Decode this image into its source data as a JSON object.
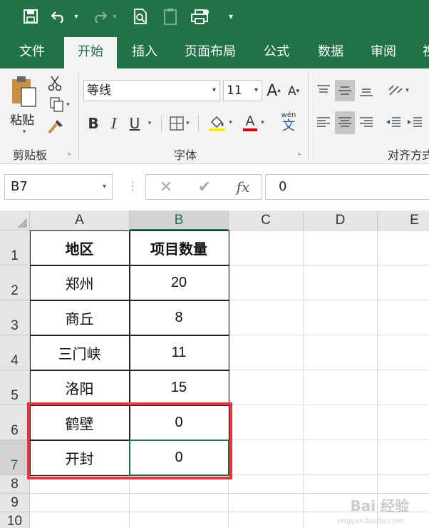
{
  "quick_access": {
    "save_icon": "save-icon",
    "undo_icon": "undo-icon",
    "redo_icon": "redo-icon",
    "print_preview_icon": "print-preview-icon",
    "clipboard_icon": "clipboard-icon",
    "print_icon": "printer-icon",
    "customize_icon": "customize-dropdown-icon"
  },
  "tabs": [
    {
      "label": "文件"
    },
    {
      "label": "开始"
    },
    {
      "label": "插入"
    },
    {
      "label": "页面布局"
    },
    {
      "label": "公式"
    },
    {
      "label": "数据"
    },
    {
      "label": "审阅"
    },
    {
      "label": "视"
    }
  ],
  "ribbon": {
    "clipboard": {
      "paste_label": "粘贴",
      "group_label": "剪贴板"
    },
    "font": {
      "font_name": "等线",
      "font_size": "11",
      "bold": "B",
      "italic": "I",
      "underline": "U",
      "font_color_glyph": "A",
      "wen_top": "wén",
      "wen_char": "文",
      "grow": "A",
      "shrink": "A",
      "group_label": "字体",
      "fill_color": "#ffee00",
      "text_color": "#e00000"
    },
    "alignment": {
      "group_label": "对齐方式"
    }
  },
  "formula_bar": {
    "name_box": "B7",
    "cancel": "✕",
    "enter": "✔",
    "fx": "fx",
    "value": "0"
  },
  "columns": [
    "A",
    "B",
    "C",
    "D",
    "E"
  ],
  "rows": [
    "1",
    "2",
    "3",
    "4",
    "5",
    "6",
    "7",
    "8",
    "9",
    "10"
  ],
  "table": {
    "headers": [
      "地区",
      "项目数量"
    ],
    "rows": [
      {
        "region": "郑州",
        "count": "20"
      },
      {
        "region": "商丘",
        "count": "8"
      },
      {
        "region": "三门峡",
        "count": "11"
      },
      {
        "region": "洛阳",
        "count": "15"
      },
      {
        "region": "鹤壁",
        "count": "0"
      },
      {
        "region": "开封",
        "count": "0"
      }
    ]
  },
  "watermark": {
    "text": "Bai 经验",
    "sub": "jingyan.baidu.com"
  },
  "colors": {
    "accent": "#217346",
    "highlight_box": "#e8343a"
  }
}
